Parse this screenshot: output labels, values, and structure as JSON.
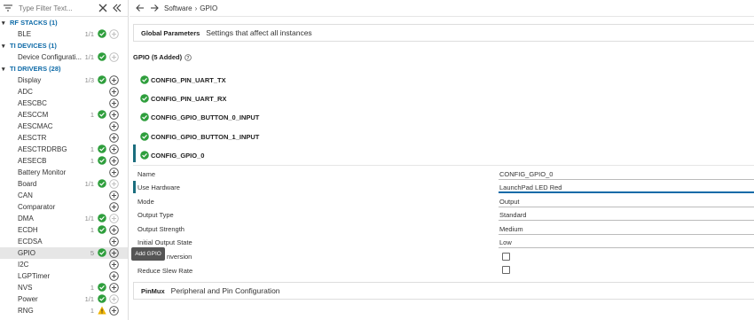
{
  "sidebar": {
    "filter_placeholder": "Type Filter Text...",
    "tree": [
      {
        "kind": "category",
        "label": "RF STACKS (1)"
      },
      {
        "kind": "module",
        "label": "BLE",
        "count": "1/1",
        "status": "ok",
        "add": "disabled"
      },
      {
        "kind": "category",
        "label": "TI DEVICES (1)"
      },
      {
        "kind": "module",
        "label": "Device Configurati...",
        "count": "1/1",
        "status": "ok",
        "add": "disabled"
      },
      {
        "kind": "category",
        "label": "TI DRIVERS (28)"
      },
      {
        "kind": "module",
        "label": "Display",
        "count": "1/3",
        "status": "ok",
        "add": "enabled"
      },
      {
        "kind": "module",
        "label": "ADC",
        "count": "",
        "status": "",
        "add": "enabled"
      },
      {
        "kind": "module",
        "label": "AESCBC",
        "count": "",
        "status": "",
        "add": "enabled"
      },
      {
        "kind": "module",
        "label": "AESCCM",
        "count": "1",
        "status": "ok",
        "add": "enabled"
      },
      {
        "kind": "module",
        "label": "AESCMAC",
        "count": "",
        "status": "",
        "add": "enabled"
      },
      {
        "kind": "module",
        "label": "AESCTR",
        "count": "",
        "status": "",
        "add": "enabled"
      },
      {
        "kind": "module",
        "label": "AESCTRDRBG",
        "count": "1",
        "status": "ok",
        "add": "enabled"
      },
      {
        "kind": "module",
        "label": "AESECB",
        "count": "1",
        "status": "ok",
        "add": "enabled"
      },
      {
        "kind": "module",
        "label": "Battery Monitor",
        "count": "",
        "status": "",
        "add": "enabled"
      },
      {
        "kind": "module",
        "label": "Board",
        "count": "1/1",
        "status": "ok",
        "add": "disabled"
      },
      {
        "kind": "module",
        "label": "CAN",
        "count": "",
        "status": "",
        "add": "enabled"
      },
      {
        "kind": "module",
        "label": "Comparator",
        "count": "",
        "status": "",
        "add": "enabled"
      },
      {
        "kind": "module",
        "label": "DMA",
        "count": "1/1",
        "status": "ok",
        "add": "disabled"
      },
      {
        "kind": "module",
        "label": "ECDH",
        "count": "1",
        "status": "ok",
        "add": "enabled"
      },
      {
        "kind": "module",
        "label": "ECDSA",
        "count": "",
        "status": "",
        "add": "enabled"
      },
      {
        "kind": "module",
        "label": "GPIO",
        "count": "5",
        "status": "ok",
        "add": "enabled",
        "selected": true
      },
      {
        "kind": "module",
        "label": "I2C",
        "count": "",
        "status": "",
        "add": "enabled"
      },
      {
        "kind": "module",
        "label": "LGPTimer",
        "count": "",
        "status": "",
        "add": "enabled"
      },
      {
        "kind": "module",
        "label": "NVS",
        "count": "1",
        "status": "ok",
        "add": "enabled"
      },
      {
        "kind": "module",
        "label": "Power",
        "count": "1/1",
        "status": "ok",
        "add": "disabled"
      },
      {
        "kind": "module",
        "label": "RNG",
        "count": "1",
        "status": "warn",
        "add": "enabled"
      }
    ]
  },
  "tooltip": "Add GPIO",
  "breadcrumb": {
    "items": [
      "Software",
      "GPIO"
    ],
    "separator": "›"
  },
  "global_params": {
    "title": "Global Parameters",
    "description": "Settings that affect all instances"
  },
  "gpio_header": "GPIO (5 Added)",
  "instances": [
    "CONFIG_PIN_UART_TX",
    "CONFIG_PIN_UART_RX",
    "CONFIG_GPIO_BUTTON_0_INPUT",
    "CONFIG_GPIO_BUTTON_1_INPUT",
    "CONFIG_GPIO_0"
  ],
  "properties": {
    "name": {
      "label": "Name",
      "value": "CONFIG_GPIO_0"
    },
    "use_hardware": {
      "label": "Use Hardware",
      "value": "LaunchPad LED Red"
    },
    "mode": {
      "label": "Mode",
      "value": "Output"
    },
    "output_type": {
      "label": "Output Type",
      "value": "Standard"
    },
    "output_strength": {
      "label": "Output Strength",
      "value": "Medium"
    },
    "initial_output_state": {
      "label": "Initial Output State",
      "value": "Low"
    },
    "invert": {
      "label": "nversion",
      "checked": false
    },
    "slew": {
      "label": "Reduce Slew Rate",
      "checked": false
    }
  },
  "pinmux": {
    "title": "PinMux",
    "description": "Peripheral and Pin Configuration"
  },
  "colors": {
    "ok": "#2e9e3c",
    "warn": "#f0b400",
    "accent": "#0f6ba8",
    "bar": "#1b6e7e"
  }
}
